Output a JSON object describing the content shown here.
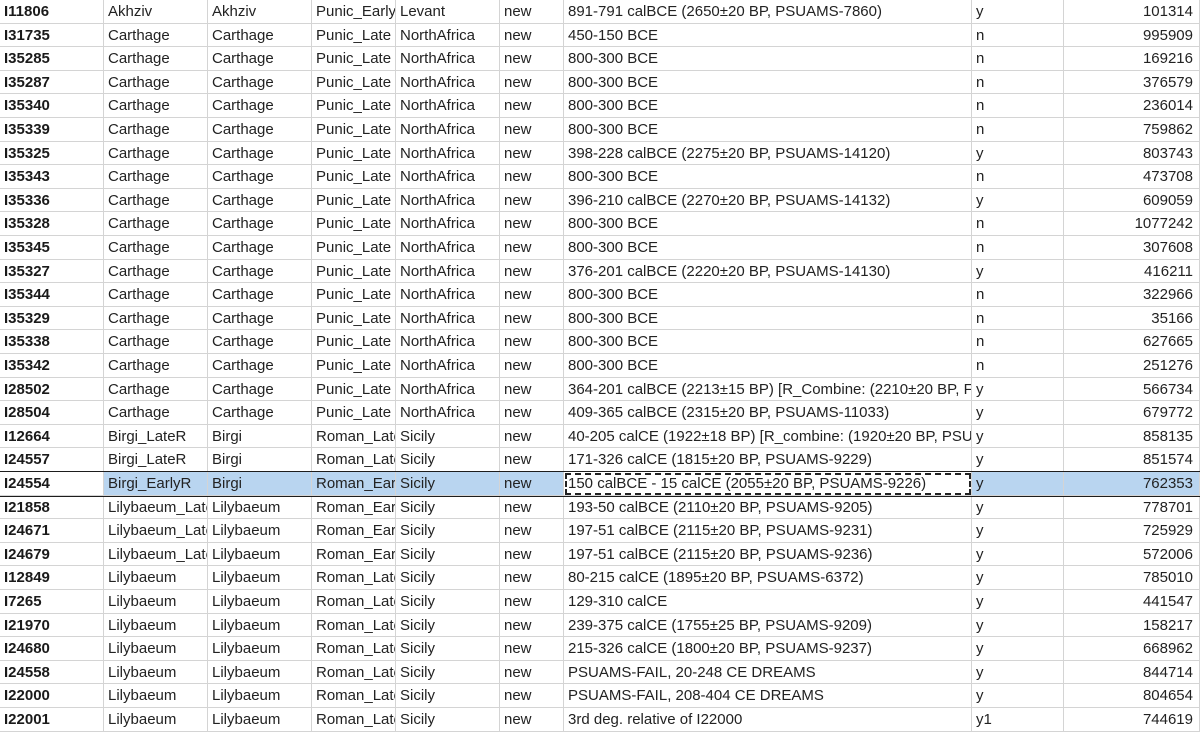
{
  "rows": [
    {
      "id": "I11806",
      "site": "Akhziv",
      "locality": "Akhziv",
      "period": "Punic_Early",
      "region": "Levant",
      "status": "new",
      "date": "891-791 calBCE (2650±20 BP, PSUAMS-7860)",
      "flag": "y",
      "value": "101314"
    },
    {
      "id": "I31735",
      "site": "Carthage",
      "locality": "Carthage",
      "period": "Punic_Late",
      "region": "NorthAfrica",
      "status": "new",
      "date": "450-150 BCE",
      "flag": "n",
      "value": "995909"
    },
    {
      "id": "I35285",
      "site": "Carthage",
      "locality": "Carthage",
      "period": "Punic_Late",
      "region": "NorthAfrica",
      "status": "new",
      "date": "800-300 BCE",
      "flag": "n",
      "value": "169216"
    },
    {
      "id": "I35287",
      "site": "Carthage",
      "locality": "Carthage",
      "period": "Punic_Late",
      "region": "NorthAfrica",
      "status": "new",
      "date": "800-300 BCE",
      "flag": "n",
      "value": "376579"
    },
    {
      "id": "I35340",
      "site": "Carthage",
      "locality": "Carthage",
      "period": "Punic_Late",
      "region": "NorthAfrica",
      "status": "new",
      "date": "800-300 BCE",
      "flag": "n",
      "value": "236014"
    },
    {
      "id": "I35339",
      "site": "Carthage",
      "locality": "Carthage",
      "period": "Punic_Late",
      "region": "NorthAfrica",
      "status": "new",
      "date": "800-300 BCE",
      "flag": "n",
      "value": "759862"
    },
    {
      "id": "I35325",
      "site": "Carthage",
      "locality": "Carthage",
      "period": "Punic_Late",
      "region": "NorthAfrica",
      "status": "new",
      "date": "398-228 calBCE (2275±20 BP, PSUAMS-14120)",
      "flag": "y",
      "value": "803743"
    },
    {
      "id": "I35343",
      "site": "Carthage",
      "locality": "Carthage",
      "period": "Punic_Late",
      "region": "NorthAfrica",
      "status": "new",
      "date": "800-300 BCE",
      "flag": "n",
      "value": "473708"
    },
    {
      "id": "I35336",
      "site": "Carthage",
      "locality": "Carthage",
      "period": "Punic_Late",
      "region": "NorthAfrica",
      "status": "new",
      "date": "396-210 calBCE (2270±20 BP, PSUAMS-14132)",
      "flag": "y",
      "value": "609059"
    },
    {
      "id": "I35328",
      "site": "Carthage",
      "locality": "Carthage",
      "period": "Punic_Late",
      "region": "NorthAfrica",
      "status": "new",
      "date": "800-300 BCE",
      "flag": "n",
      "value": "1077242"
    },
    {
      "id": "I35345",
      "site": "Carthage",
      "locality": "Carthage",
      "period": "Punic_Late",
      "region": "NorthAfrica",
      "status": "new",
      "date": "800-300 BCE",
      "flag": "n",
      "value": "307608"
    },
    {
      "id": "I35327",
      "site": "Carthage",
      "locality": "Carthage",
      "period": "Punic_Late",
      "region": "NorthAfrica",
      "status": "new",
      "date": "376-201 calBCE (2220±20 BP, PSUAMS-14130)",
      "flag": "y",
      "value": "416211"
    },
    {
      "id": "I35344",
      "site": "Carthage",
      "locality": "Carthage",
      "period": "Punic_Late",
      "region": "NorthAfrica",
      "status": "new",
      "date": "800-300 BCE",
      "flag": "n",
      "value": "322966"
    },
    {
      "id": "I35329",
      "site": "Carthage",
      "locality": "Carthage",
      "period": "Punic_Late",
      "region": "NorthAfrica",
      "status": "new",
      "date": "800-300 BCE",
      "flag": "n",
      "value": "35166"
    },
    {
      "id": "I35338",
      "site": "Carthage",
      "locality": "Carthage",
      "period": "Punic_Late",
      "region": "NorthAfrica",
      "status": "new",
      "date": "800-300 BCE",
      "flag": "n",
      "value": "627665"
    },
    {
      "id": "I35342",
      "site": "Carthage",
      "locality": "Carthage",
      "period": "Punic_Late",
      "region": "NorthAfrica",
      "status": "new",
      "date": "800-300 BCE",
      "flag": "n",
      "value": "251276"
    },
    {
      "id": "I28502",
      "site": "Carthage",
      "locality": "Carthage",
      "period": "Punic_Late",
      "region": "NorthAfrica",
      "status": "new",
      "date": "364-201 calBCE (2213±15 BP) [R_Combine: (2210±20 BP, F",
      "flag": "y",
      "value": "566734"
    },
    {
      "id": "I28504",
      "site": "Carthage",
      "locality": "Carthage",
      "period": "Punic_Late",
      "region": "NorthAfrica",
      "status": "new",
      "date": "409-365 calBCE (2315±20 BP, PSUAMS-11033)",
      "flag": "y",
      "value": "679772"
    },
    {
      "id": "I12664",
      "site": "Birgi_LateR",
      "locality": "Birgi",
      "period": "Roman_Late",
      "region": "Sicily",
      "status": "new",
      "date": "40-205 calCE (1922±18 BP) [R_combine: (1920±20 BP, PSU",
      "flag": "y",
      "value": "858135"
    },
    {
      "id": "I24557",
      "site": "Birgi_LateR",
      "locality": "Birgi",
      "period": "Roman_Late",
      "region": "Sicily",
      "status": "new",
      "date": "171-326 calCE (1815±20 BP, PSUAMS-9229)",
      "flag": "y",
      "value": "851574"
    },
    {
      "id": "I24554",
      "site": "Birgi_EarlyR",
      "locality": "Birgi",
      "period": "Roman_Earl",
      "region": "Sicily",
      "status": "new",
      "date": "150 calBCE - 15 calCE (2055±20 BP, PSUAMS-9226)",
      "flag": "y",
      "value": "762353"
    },
    {
      "id": "I21858",
      "site": "Lilybaeum_Late",
      "locality": "Lilybaeum",
      "period": "Roman_Earl",
      "region": "Sicily",
      "status": "new",
      "date": "193-50 calBCE (2110±20 BP, PSUAMS-9205)",
      "flag": "y",
      "value": "778701"
    },
    {
      "id": "I24671",
      "site": "Lilybaeum_Late",
      "locality": "Lilybaeum",
      "period": "Roman_Earl",
      "region": "Sicily",
      "status": "new",
      "date": "197-51 calBCE (2115±20 BP, PSUAMS-9231)",
      "flag": "y",
      "value": "725929"
    },
    {
      "id": "I24679",
      "site": "Lilybaeum_Late",
      "locality": "Lilybaeum",
      "period": "Roman_Earl",
      "region": "Sicily",
      "status": "new",
      "date": "197-51 calBCE (2115±20 BP, PSUAMS-9236)",
      "flag": "y",
      "value": "572006"
    },
    {
      "id": "I12849",
      "site": "Lilybaeum",
      "locality": "Lilybaeum",
      "period": "Roman_Late",
      "region": "Sicily",
      "status": "new",
      "date": "80-215 calCE (1895±20 BP, PSUAMS-6372)",
      "flag": "y",
      "value": "785010"
    },
    {
      "id": "I7265",
      "site": "Lilybaeum",
      "locality": "Lilybaeum",
      "period": "Roman_Late",
      "region": "Sicily",
      "status": "new",
      "date": "129-310 calCE",
      "flag": "y",
      "value": "441547"
    },
    {
      "id": "I21970",
      "site": "Lilybaeum",
      "locality": "Lilybaeum",
      "period": "Roman_Late",
      "region": "Sicily",
      "status": "new",
      "date": "239-375 calCE (1755±25 BP, PSUAMS-9209)",
      "flag": "y",
      "value": "158217"
    },
    {
      "id": "I24680",
      "site": "Lilybaeum",
      "locality": "Lilybaeum",
      "period": "Roman_Late",
      "region": "Sicily",
      "status": "new",
      "date": "215-326 calCE (1800±20 BP, PSUAMS-9237)",
      "flag": "y",
      "value": "668962"
    },
    {
      "id": "I24558",
      "site": "Lilybaeum",
      "locality": "Lilybaeum",
      "period": "Roman_Late",
      "region": "Sicily",
      "status": "new",
      "date": "PSUAMS-FAIL, 20-248 CE DREAMS",
      "flag": "y",
      "value": "844714"
    },
    {
      "id": "I22000",
      "site": "Lilybaeum",
      "locality": "Lilybaeum",
      "period": "Roman_Late",
      "region": "Sicily",
      "status": "new",
      "date": "PSUAMS-FAIL, 208-404 CE DREAMS",
      "flag": "y",
      "value": "804654"
    },
    {
      "id": "I22001",
      "site": "Lilybaeum",
      "locality": "Lilybaeum",
      "period": "Roman_Late",
      "region": "Sicily",
      "status": "new",
      "date": "3rd deg. relative of I22000",
      "flag": "y1",
      "value": "744619"
    }
  ],
  "selected_row_index": 20
}
